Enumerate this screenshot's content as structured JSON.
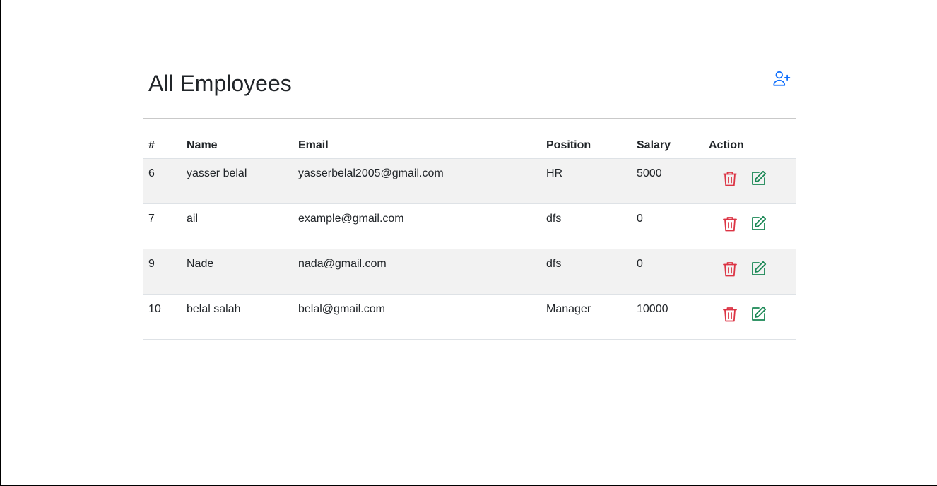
{
  "page": {
    "title": "All Employees"
  },
  "toolbar": {
    "add_icon": "person-plus-icon",
    "accent": "#0d6efd"
  },
  "table": {
    "headers": [
      "#",
      "Name",
      "Email",
      "Position",
      "Salary",
      "Action"
    ],
    "rows": [
      {
        "id": "6",
        "name": "yasser belal",
        "email": "yasserbelal2005@gmail.com",
        "position": "HR",
        "salary": "5000"
      },
      {
        "id": "7",
        "name": "ail",
        "email": "example@gmail.com",
        "position": "dfs",
        "salary": "0"
      },
      {
        "id": "9",
        "name": "Nade",
        "email": "nada@gmail.com",
        "position": "dfs",
        "salary": "0"
      },
      {
        "id": "10",
        "name": "belal salah",
        "email": "belal@gmail.com",
        "position": "Manager",
        "salary": "10000"
      }
    ],
    "actions": {
      "delete_icon": "trash-icon",
      "delete_color": "#dc3545",
      "edit_icon": "edit-icon",
      "edit_color": "#198754"
    }
  }
}
